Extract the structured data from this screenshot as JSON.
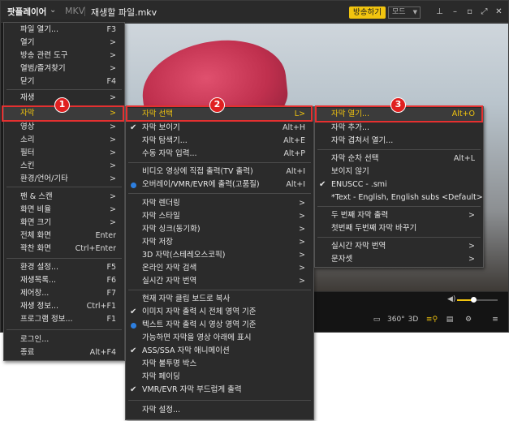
{
  "titlebar": {
    "app_name": "팟플레이어",
    "format": "MKV",
    "filename": "재생할 파일.mkv",
    "broadcast_button": "방송하기",
    "mode_select": "모드"
  },
  "colors": {
    "accent": "#f1c40f",
    "highlight_box": "#e53030",
    "badge": "#e02020",
    "radio": "#2d7fe0",
    "menu_bg": "#2b2b2b"
  },
  "volume_level": 0.4,
  "controls": {
    "icons": [
      "screen-icon",
      "360-icon",
      "3d-icon",
      "subtitle-search-icon",
      "playlist-icon",
      "settings-icon",
      "menu-icon"
    ],
    "labels": {
      "360": "360°",
      "3d": "3D"
    }
  },
  "main_menu": {
    "items": [
      {
        "label": "파일 열기...",
        "shortcut": "F3"
      },
      {
        "label": "열기",
        "shortcut": ">"
      },
      {
        "label": "방송 관련 도구",
        "shortcut": ">"
      },
      {
        "label": "열범/즐겨찾기",
        "shortcut": ">"
      },
      {
        "label": "닫기",
        "shortcut": "F4"
      },
      {
        "label": "재생",
        "shortcut": ">"
      },
      {
        "label": "자막",
        "shortcut": ">"
      },
      {
        "label": "영상",
        "shortcut": ">"
      },
      {
        "label": "소리",
        "shortcut": ">"
      },
      {
        "label": "필터",
        "shortcut": ">"
      },
      {
        "label": "스킨",
        "shortcut": ">"
      },
      {
        "label": "환경/언어/기타",
        "shortcut": ">"
      },
      {
        "label": "팬 & 스캔",
        "shortcut": ">"
      },
      {
        "label": "화면 비율",
        "shortcut": ">"
      },
      {
        "label": "화면 크기",
        "shortcut": ">"
      },
      {
        "label": "전체 화면",
        "shortcut": "Enter"
      },
      {
        "label": "꽉찬 화면",
        "shortcut": "Ctrl+Enter"
      },
      {
        "label": "환경 설정...",
        "shortcut": "F5"
      },
      {
        "label": "재생목록...",
        "shortcut": "F6"
      },
      {
        "label": "제어창...",
        "shortcut": "F7"
      },
      {
        "label": "재생 정보...",
        "shortcut": "Ctrl+F1"
      },
      {
        "label": "프로그램 정보...",
        "shortcut": "F1"
      },
      {
        "label": "로그인...",
        "shortcut": ""
      },
      {
        "label": "종료",
        "shortcut": "Alt+F4"
      }
    ]
  },
  "subtitle_menu": {
    "items": [
      {
        "label": "자막 선택",
        "shortcut": "L>"
      },
      {
        "label": "자막 보이기",
        "shortcut": "Alt+H"
      },
      {
        "label": "자막 탐색기...",
        "shortcut": "Alt+E"
      },
      {
        "label": "수동 자막 입력...",
        "shortcut": "Alt+P"
      },
      {
        "label": "비디오 영상에 직접 출력(TV 출력)",
        "shortcut": "Alt+I"
      },
      {
        "label": "오버레이/VMR/EVR에 출력(고품질)",
        "shortcut": "Alt+I"
      },
      {
        "label": "자막 렌더링",
        "shortcut": ">"
      },
      {
        "label": "자막 스타일",
        "shortcut": ">"
      },
      {
        "label": "자막 싱크(동기화)",
        "shortcut": ">"
      },
      {
        "label": "자막 저장",
        "shortcut": ">"
      },
      {
        "label": "3D 자막(스테레오스코픽)",
        "shortcut": ">"
      },
      {
        "label": "온라인 자막 검색",
        "shortcut": ">"
      },
      {
        "label": "실시간 자막 번역",
        "shortcut": ">"
      },
      {
        "label": "현재 자막 클립 보드로 복사",
        "shortcut": ""
      },
      {
        "label": "이미지 자막 출력 시 전체 영역 기준",
        "shortcut": ""
      },
      {
        "label": "텍스트 자막 출력 시 영상 영역 기준",
        "shortcut": ""
      },
      {
        "label": "가능하면 자막을 영상 아래에 표시",
        "shortcut": ""
      },
      {
        "label": "ASS/SSA 자막 애니메이션",
        "shortcut": ""
      },
      {
        "label": "자막 불투명 박스",
        "shortcut": ""
      },
      {
        "label": "자막 페이딩",
        "shortcut": ""
      },
      {
        "label": "VMR/EVR 자막 부드럽게 출력",
        "shortcut": ""
      },
      {
        "label": "자막 설정...",
        "shortcut": ""
      }
    ]
  },
  "select_menu": {
    "items": [
      {
        "label": "자막 열기...",
        "shortcut": "Alt+O"
      },
      {
        "label": "자막 추가...",
        "shortcut": ""
      },
      {
        "label": "자막 겹쳐서 열기...",
        "shortcut": ""
      },
      {
        "label": "자막 순차 선택",
        "shortcut": "Alt+L"
      },
      {
        "label": "보이지 않기",
        "shortcut": ""
      },
      {
        "label": "ENUSCC - .smi",
        "shortcut": ""
      },
      {
        "label": "*Text - English, English subs <Default>",
        "shortcut": ""
      },
      {
        "label": "두 번째 자막 출력",
        "shortcut": ">"
      },
      {
        "label": "첫번째 두번째 자막 바꾸기",
        "shortcut": ""
      },
      {
        "label": "실시간 자막 번역",
        "shortcut": ">"
      },
      {
        "label": "문자셋",
        "shortcut": ">"
      }
    ]
  },
  "badges": [
    "1",
    "2",
    "3"
  ]
}
